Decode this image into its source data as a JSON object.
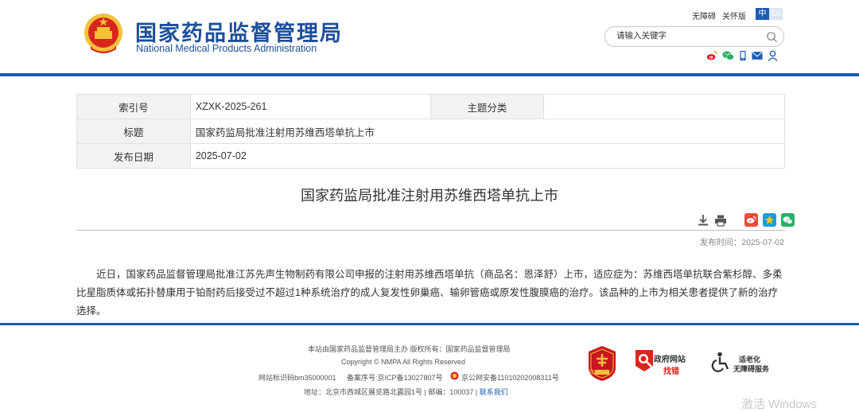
{
  "header": {
    "brand_cn": "国家药品监督管理局",
    "brand_en": "National Medical Products Administration",
    "links": [
      "无障碍",
      "关怀版"
    ],
    "lang_cn": "中",
    "lang_en": "En",
    "search_placeholder": "请输入关键字"
  },
  "meta": {
    "index_label": "索引号",
    "index_value": "XZXK-2025-261",
    "topic_label": "主题分类",
    "topic_value": "",
    "title_label": "标题",
    "title_value": "国家药监局批准注射用苏维西塔单抗上市",
    "date_label": "发布日期",
    "date_value": "2025-07-02"
  },
  "article": {
    "title": "国家药监局批准注射用苏维西塔单抗上市",
    "pubtime": "发布时间：2025-07-02",
    "content": "近日，国家药品监督管理局批准江苏先声生物制药有限公司申报的注射用苏维西塔单抗（商品名：恩泽舒）上市，适应症为：苏维西塔单抗联合紫杉醇、多柔比星脂质体或拓扑替康用于铂耐药后接受过不超过1种系统治疗的成人复发性卵巢癌、输卵管癌或原发性腹膜癌的治疗。该品种的上市为相关患者提供了新的治疗选择。"
  },
  "footer": {
    "line1": "本站由国家药品监督管理局主办 版权所有：国家药品监督管理局",
    "line2": "Copyright © NMPA All Rights Reserved",
    "site_id": "网站标识码bm35000001",
    "icp": "备案序号:京ICP备13027807号",
    "police": "京公网安备11010202008311号",
    "address": "地址：北京市西城区展览路北露园1号 | 邮编：100037 |",
    "contact": "联系我们",
    "badge_party": "党政机关",
    "badge_gov_1": "政府网站",
    "badge_gov_2": "找错",
    "badge_access_1": "适老化",
    "badge_access_2": "无障碍服务"
  },
  "watermark": "激活 Windows",
  "colors": {
    "brand_blue": "#1c5bb3",
    "title_blue": "#1c4f9c",
    "emblem_red": "#d9261c",
    "emblem_gold": "#f3c13a"
  },
  "icons": [
    "national-emblem-icon",
    "search-icon",
    "weibo-icon",
    "wechat-icon",
    "mobile-icon",
    "mail-icon",
    "user-icon",
    "download-icon",
    "print-icon",
    "share-weibo-icon",
    "share-qzone-icon",
    "share-wechat-icon"
  ]
}
